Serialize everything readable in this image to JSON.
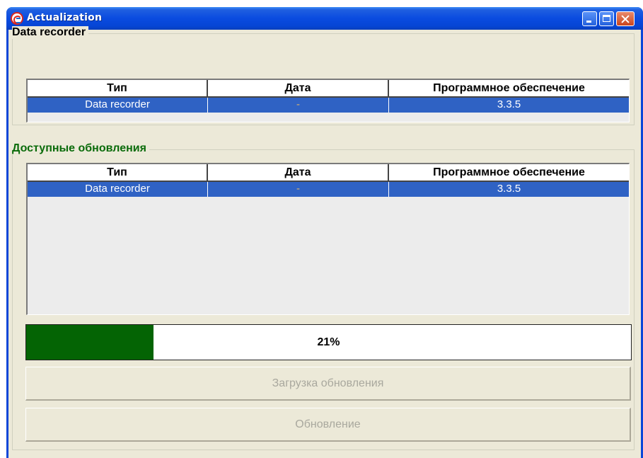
{
  "window": {
    "title": "Actualization",
    "icon": "app-logo-icon",
    "controls": [
      "minimize-icon",
      "maximize-icon",
      "close-icon"
    ]
  },
  "colors": {
    "titlebar": "#0a4be0",
    "selection": "#2f62c4",
    "progress_fill": "#046404",
    "group_title_1": "#000000",
    "group_title_2": "#0a6b0a"
  },
  "device_group": {
    "title": "Data recorder",
    "columns": [
      "Тип",
      "Дата",
      "Программное обеспечение"
    ],
    "rows": [
      [
        "Data recorder",
        "-",
        "3.3.5"
      ]
    ]
  },
  "updates_group": {
    "title": "Доступные обновления",
    "columns": [
      "Тип",
      "Дата",
      "Программное обеспечение"
    ],
    "rows": [
      [
        "Data recorder",
        "-",
        "3.3.5"
      ]
    ]
  },
  "progress": {
    "value": 0.21,
    "label": "21%"
  },
  "buttons": {
    "download": "Загрузка обновления",
    "update": "Обновление"
  }
}
